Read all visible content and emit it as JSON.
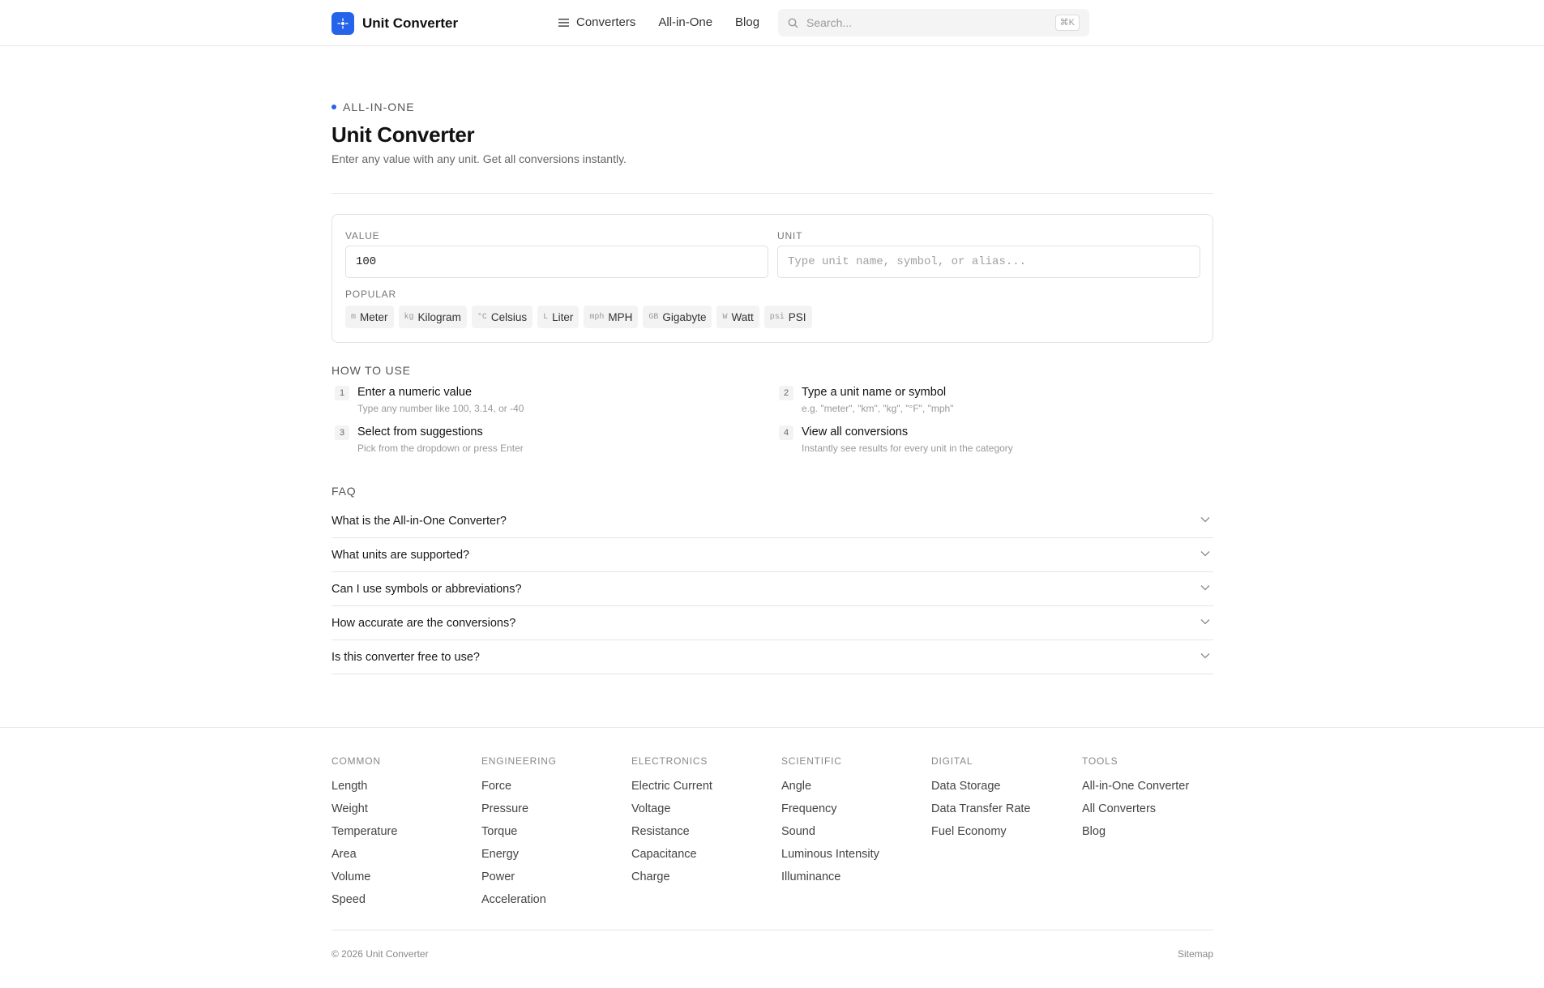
{
  "header": {
    "brand_name": "Unit Converter",
    "nav": [
      {
        "label": "Converters"
      },
      {
        "label": "All-in-One"
      },
      {
        "label": "Blog"
      }
    ],
    "search_placeholder": "Search...",
    "search_shortcut": "⌘K"
  },
  "hero": {
    "eyebrow": "ALL-IN-ONE",
    "title": "Unit Converter",
    "subtitle": "Enter any value with any unit. Get all conversions instantly."
  },
  "converter": {
    "value_label": "VALUE",
    "value": "100",
    "unit_label": "UNIT",
    "unit_placeholder": "Type unit name, symbol, or alias...",
    "popular_label": "POPULAR",
    "popular": [
      {
        "symbol": "m",
        "name": "Meter"
      },
      {
        "symbol": "kg",
        "name": "Kilogram"
      },
      {
        "symbol": "°C",
        "name": "Celsius"
      },
      {
        "symbol": "L",
        "name": "Liter"
      },
      {
        "symbol": "mph",
        "name": "MPH"
      },
      {
        "symbol": "GB",
        "name": "Gigabyte"
      },
      {
        "symbol": "W",
        "name": "Watt"
      },
      {
        "symbol": "psi",
        "name": "PSI"
      }
    ]
  },
  "how_to": {
    "heading": "HOW TO USE",
    "steps": [
      {
        "num": "1",
        "title": "Enter a numeric value",
        "desc": "Type any number like 100, 3.14, or -40"
      },
      {
        "num": "2",
        "title": "Type a unit name or symbol",
        "desc": "e.g. \"meter\", \"km\", \"kg\", \"°F\", \"mph\""
      },
      {
        "num": "3",
        "title": "Select from suggestions",
        "desc": "Pick from the dropdown or press Enter"
      },
      {
        "num": "4",
        "title": "View all conversions",
        "desc": "Instantly see results for every unit in the category"
      }
    ]
  },
  "faq": {
    "heading": "FAQ",
    "items": [
      {
        "q": "What is the All-in-One Converter?"
      },
      {
        "q": "What units are supported?"
      },
      {
        "q": "Can I use symbols or abbreviations?"
      },
      {
        "q": "How accurate are the conversions?"
      },
      {
        "q": "Is this converter free to use?"
      }
    ]
  },
  "footer": {
    "columns": [
      {
        "heading": "COMMON",
        "links": [
          "Length",
          "Weight",
          "Temperature",
          "Area",
          "Volume",
          "Speed"
        ]
      },
      {
        "heading": "ENGINEERING",
        "links": [
          "Force",
          "Pressure",
          "Torque",
          "Energy",
          "Power",
          "Acceleration"
        ]
      },
      {
        "heading": "ELECTRONICS",
        "links": [
          "Electric Current",
          "Voltage",
          "Resistance",
          "Capacitance",
          "Charge"
        ]
      },
      {
        "heading": "SCIENTIFIC",
        "links": [
          "Angle",
          "Frequency",
          "Sound",
          "Luminous Intensity",
          "Illuminance"
        ]
      },
      {
        "heading": "DIGITAL",
        "links": [
          "Data Storage",
          "Data Transfer Rate",
          "Fuel Economy"
        ]
      },
      {
        "heading": "TOOLS",
        "links": [
          "All-in-One Converter",
          "All Converters",
          "Blog"
        ]
      }
    ],
    "copyright": "© 2026 Unit Converter",
    "sitemap": "Sitemap"
  },
  "colors": {
    "accent": "#2563eb"
  }
}
